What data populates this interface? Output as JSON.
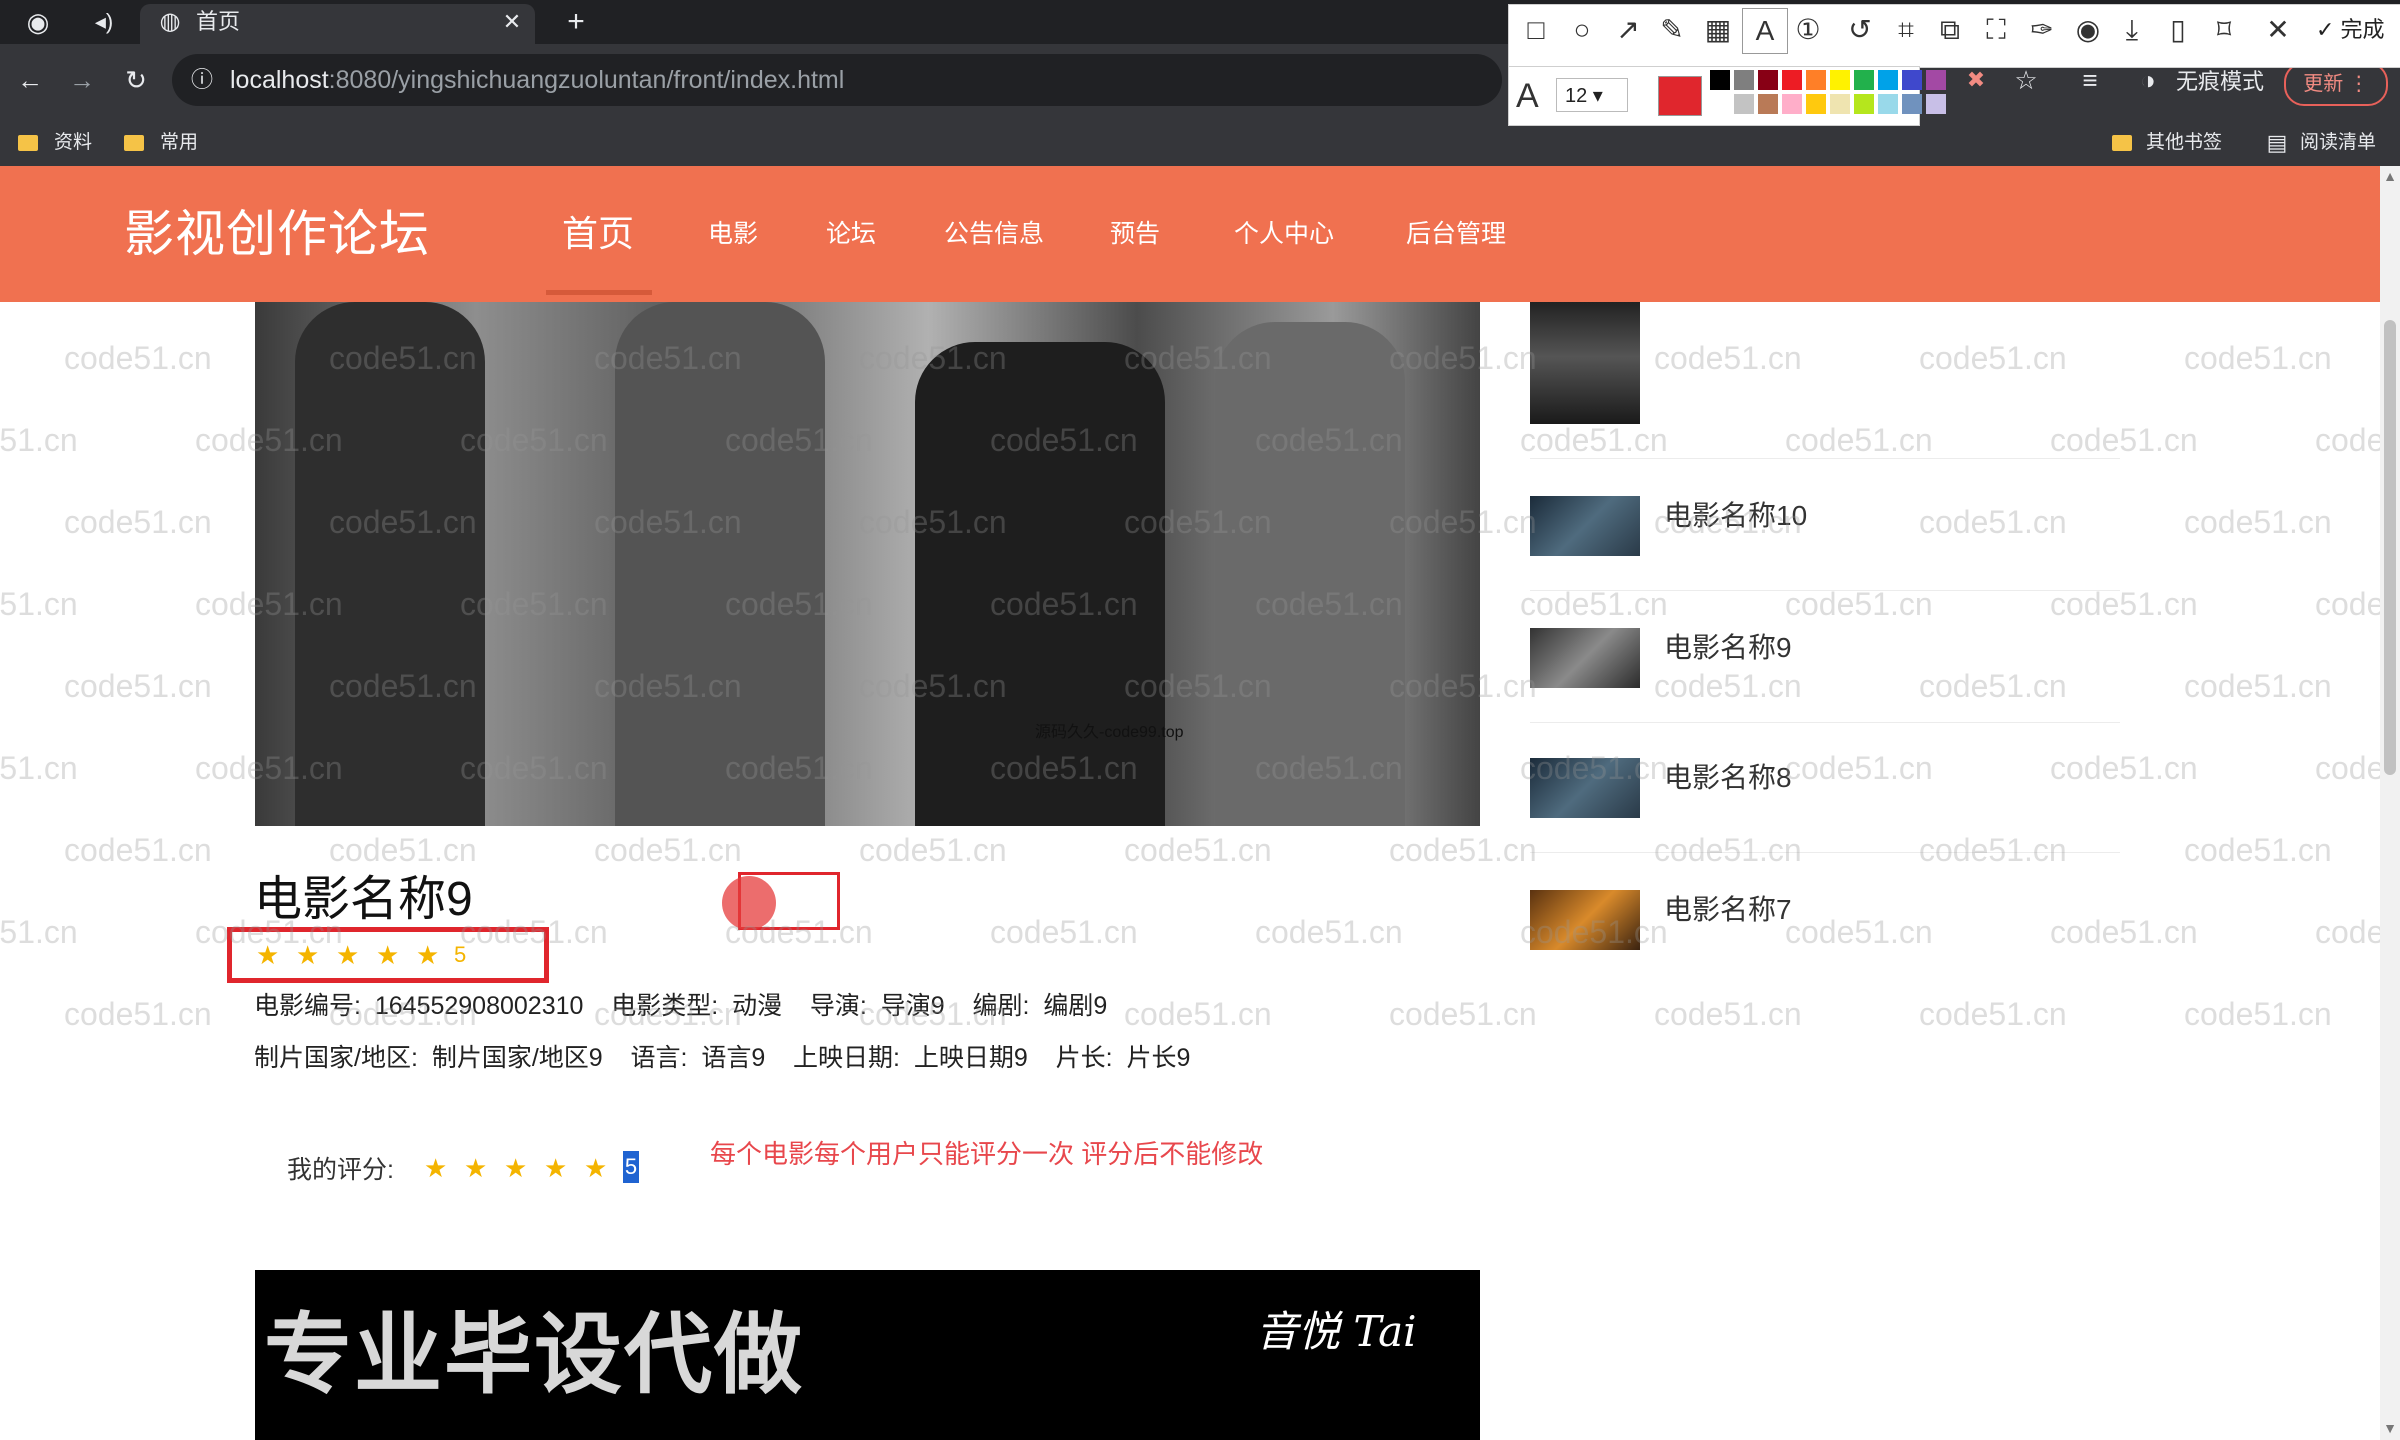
{
  "browser": {
    "tab_title": "首页",
    "url_host": "localhost",
    "url_rest": ":8080/yingshichuangzuoluntan/front/index.html",
    "bookmarks": [
      "资料",
      "常用"
    ],
    "bookmarks_right": [
      "其他书签",
      "阅读清单"
    ],
    "incognito_label": "无痕模式",
    "update_label": "更新",
    "icons": [
      "back-icon",
      "forward-icon",
      "reload-icon",
      "info-icon",
      "star-icon",
      "profile-icon",
      "menu-icon"
    ]
  },
  "screenshot_tool": {
    "done_label": "完成",
    "font_size": "12",
    "palette": [
      "#000000",
      "#7f7f7f",
      "#880015",
      "#ed1c24",
      "#ff7f27",
      "#fff200",
      "#22b14c",
      "#00a2e8",
      "#3f48cc",
      "#a349a4",
      "#ffffff",
      "#c3c3c3",
      "#b97a57",
      "#ffaec9",
      "#ffc90e",
      "#efe4b0",
      "#b5e61d",
      "#99d9ea",
      "#7092be",
      "#c8bfe7",
      "#e0262d"
    ]
  },
  "site": {
    "logo": "影视创作论坛",
    "nav": [
      "首页",
      "电影",
      "论坛",
      "公告信息",
      "预告",
      "个人中心",
      "后台管理"
    ],
    "active_nav": "首页"
  },
  "movie": {
    "title": "电影名称9",
    "rating": "5",
    "info_line1": {
      "code_label": "电影编号:",
      "code_value": "164552908002310",
      "type_label": "电影类型:",
      "type_value": "动漫",
      "director_label": "导演:",
      "director_value": "导演9",
      "writer_label": "编剧:",
      "writer_value": "编剧9"
    },
    "info_line2": {
      "region_label": "制片国家/地区:",
      "region_value": "制片国家/地区9",
      "lang_label": "语言:",
      "lang_value": "语言9",
      "date_label": "上映日期:",
      "date_value": "上映日期9",
      "length_label": "片长:",
      "length_value": "片长9"
    },
    "my_rating_label": "我的评分:",
    "my_rating_value": "5",
    "notice": "每个电影每个用户只能评分一次 评分后不能修改",
    "poster_watermark": "源码久久-code99.top"
  },
  "sidebar": [
    {
      "title": ""
    },
    {
      "title": "电影名称10"
    },
    {
      "title": "电影名称9"
    },
    {
      "title": "电影名称8"
    },
    {
      "title": "电影名称7"
    }
  ],
  "banner": {
    "text": "专业毕设代做",
    "signature": "音悦 Tai"
  },
  "watermark": "code51.cn"
}
